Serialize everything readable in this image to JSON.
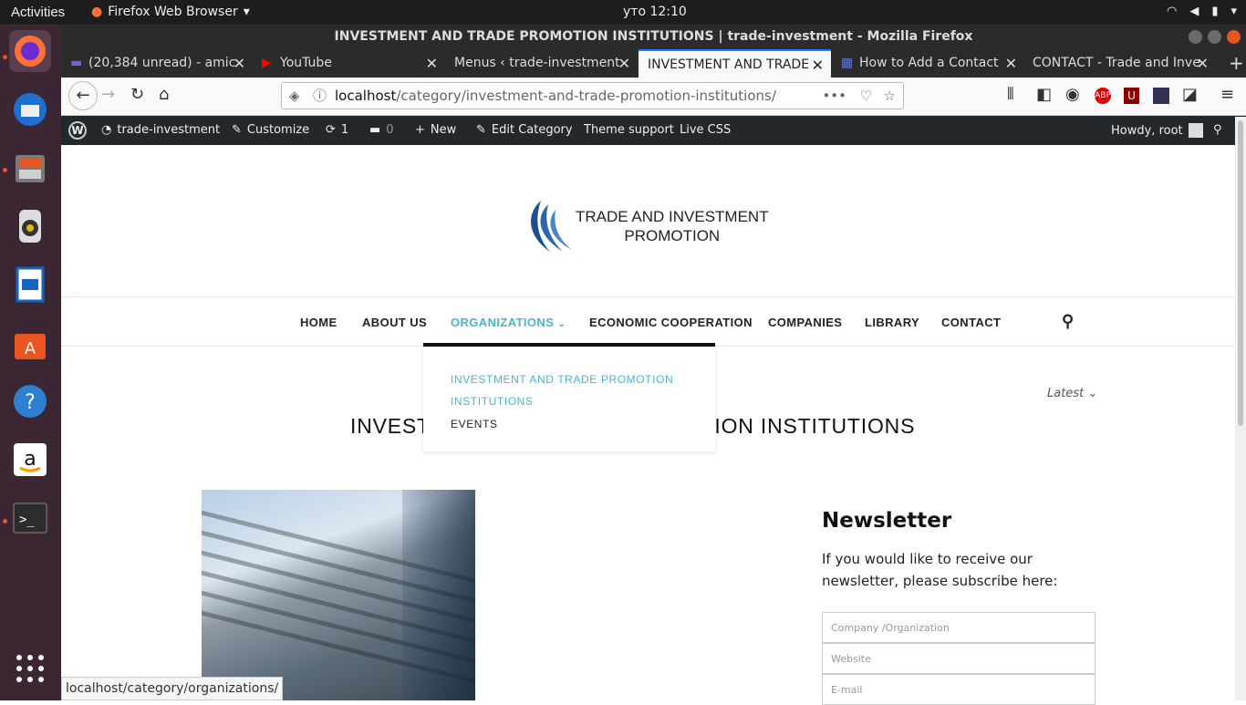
{
  "system": {
    "activities": "Activities",
    "app_name": "Firefox Web Browser",
    "clock": "уто 12:10"
  },
  "window": {
    "title": "INVESTMENT AND TRADE PROMOTION INSTITUTIONS | trade-investment - Mozilla Firefox"
  },
  "tabs": [
    {
      "label": "(20,384 unread) - amic",
      "icon": "mail-icon"
    },
    {
      "label": "YouTube",
      "icon": "youtube-icon"
    },
    {
      "label": "Menus ‹ trade-investment",
      "icon": ""
    },
    {
      "label": "INVESTMENT AND TRADE",
      "icon": ""
    },
    {
      "label": "How to Add a Contact",
      "icon": "grid-icon"
    },
    {
      "label": "CONTACT - Trade and Inve",
      "icon": ""
    }
  ],
  "url": {
    "host": "localhost",
    "path": "/category/investment-and-trade-promotion-institutions/"
  },
  "wp_admin": {
    "site": "trade-investment",
    "customize": "Customize",
    "updates": "1",
    "comments": "0",
    "new": "New",
    "edit": "Edit Category",
    "theme_support": "Theme support",
    "live_css": "Live CSS",
    "howdy": "Howdy, root"
  },
  "site": {
    "logo_line1": "TRADE AND INVESTMENT",
    "logo_line2": "PROMOTION"
  },
  "menu": {
    "home": "HOME",
    "about": "ABOUT US",
    "organizations": "ORGANIZATIONS",
    "economic": "ECONOMIC COOPERATION",
    "companies": "COMPANIES",
    "library": "LIBRARY",
    "contact": "CONTACT"
  },
  "submenu": {
    "item1": "INVESTMENT AND TRADE PROMOTION INSTITUTIONS",
    "item2": "EVENTS"
  },
  "content": {
    "sort": "Latest",
    "title_left": "INVEST",
    "title_right": "OTION INSTITUTIONS"
  },
  "newsletter": {
    "heading": "Newsletter",
    "text": "If you would like to receive our newsletter, please subscribe here:",
    "company_placeholder": "Company /Organization",
    "website_placeholder": "Website",
    "email_placeholder": "E-mail"
  },
  "status_url": "localhost/category/organizations/",
  "colors": {
    "accent": "#4bb4cc",
    "ubuntu_orange": "#e95420",
    "wp_bar": "#23282d"
  }
}
